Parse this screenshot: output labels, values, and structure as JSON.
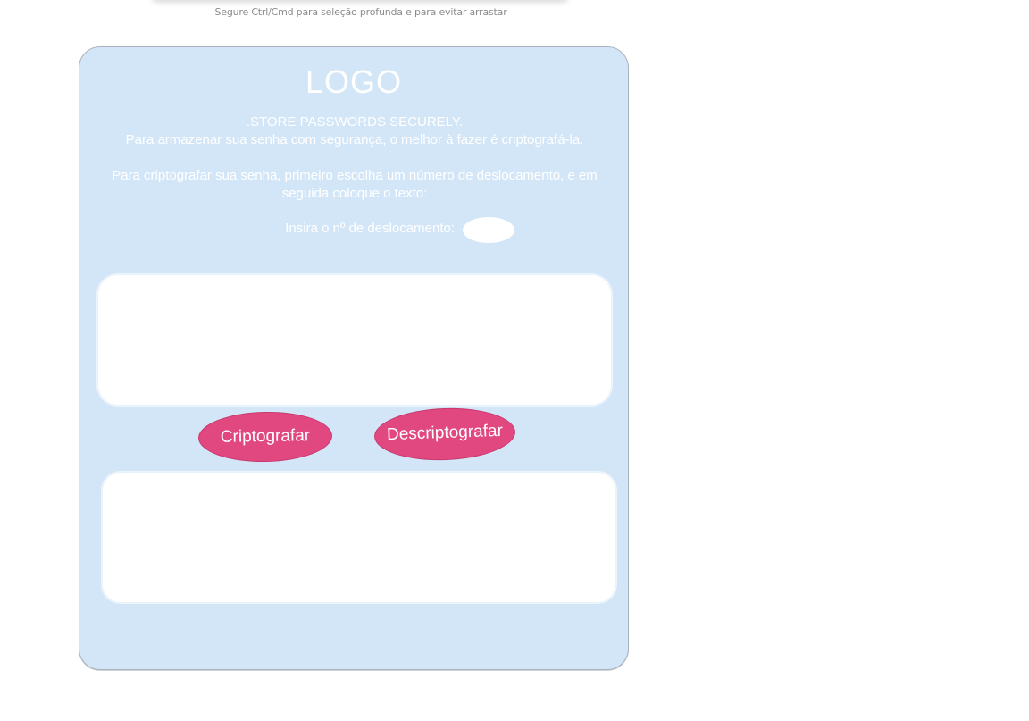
{
  "hint": "Segure Ctrl/Cmd para seleção profunda e para evitar arrastar",
  "card": {
    "logo": "LOGO",
    "tagline": ".STORE PASSWORDS SECURELY.",
    "intro": "Para armazenar sua senha com segurança, o melhor à fazer é criptografá-la.",
    "instructions": "Para criptografar sua senha, primeiro escolha um número de deslocamento, e em seguida coloque o texto:",
    "shift_label": "Insira o nº de deslocamento:",
    "shift_value": "",
    "input_text": "",
    "encrypt_label": "Criptografar",
    "decrypt_label": "Descriptografar",
    "output_text": ""
  },
  "colors": {
    "card_background": "#d3e6f8",
    "button": "#e14880",
    "text": "#ffffff"
  }
}
